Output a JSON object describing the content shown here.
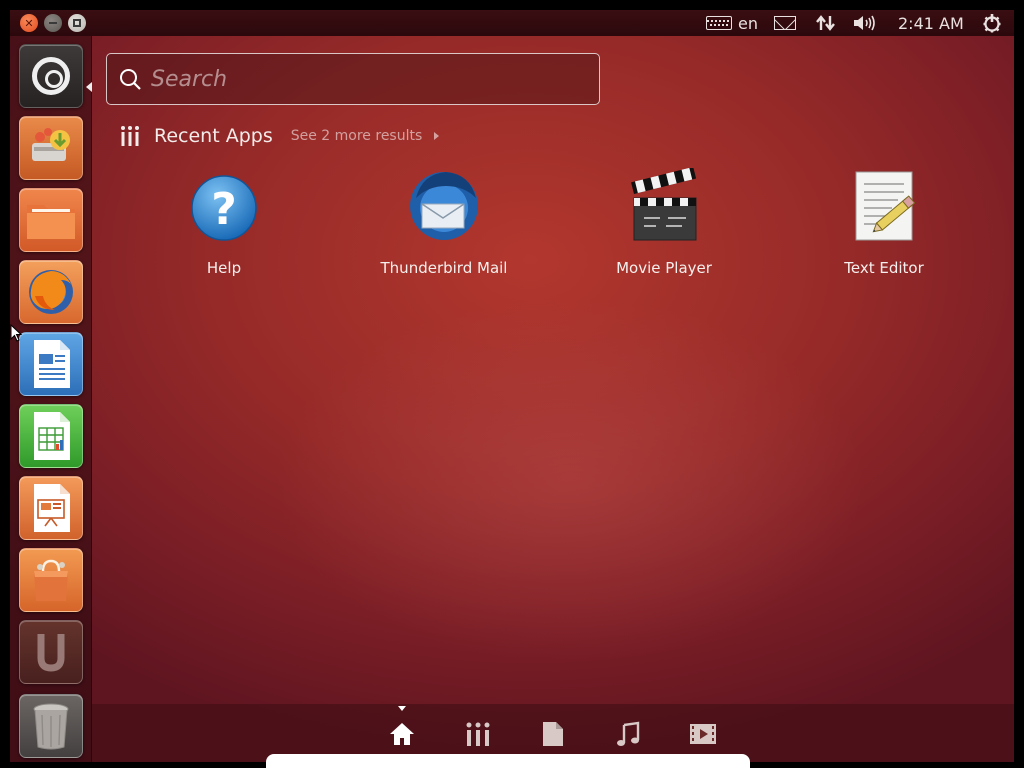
{
  "window_controls": {
    "close_glyph": "✕"
  },
  "top_panel": {
    "keyboard_layout": "en",
    "clock": "2:41 AM"
  },
  "launcher": {
    "items": [
      {
        "name": "dash-home",
        "icon": "ubuntu-logo-icon"
      },
      {
        "name": "ubuntu-one",
        "icon": "ubuntu-one-icon"
      },
      {
        "name": "files",
        "icon": "folder-icon"
      },
      {
        "name": "firefox",
        "icon": "firefox-icon"
      },
      {
        "name": "libreoffice-writer",
        "icon": "writer-icon"
      },
      {
        "name": "libreoffice-calc",
        "icon": "calc-icon"
      },
      {
        "name": "libreoffice-impress",
        "icon": "impress-icon"
      },
      {
        "name": "software-center",
        "icon": "shopping-bag-icon"
      },
      {
        "name": "ubuntu-one-music",
        "icon": "ubuntu-u-icon"
      },
      {
        "name": "trash",
        "icon": "trash-icon"
      }
    ]
  },
  "search": {
    "placeholder": "Search",
    "value": ""
  },
  "recent_apps": {
    "title": "Recent Apps",
    "see_more": "See 2 more results",
    "apps": [
      {
        "label": "Help",
        "icon": "help-icon"
      },
      {
        "label": "Thunderbird Mail",
        "icon": "thunderbird-icon"
      },
      {
        "label": "Movie Player",
        "icon": "clapperboard-icon"
      },
      {
        "label": "Text Editor",
        "icon": "text-editor-icon"
      }
    ]
  },
  "lenses": [
    {
      "name": "home",
      "icon": "home-icon",
      "active": true
    },
    {
      "name": "applications",
      "icon": "applications-icon",
      "active": false
    },
    {
      "name": "files",
      "icon": "file-icon",
      "active": false
    },
    {
      "name": "music",
      "icon": "music-note-icon",
      "active": false
    },
    {
      "name": "video",
      "icon": "video-icon",
      "active": false
    }
  ]
}
